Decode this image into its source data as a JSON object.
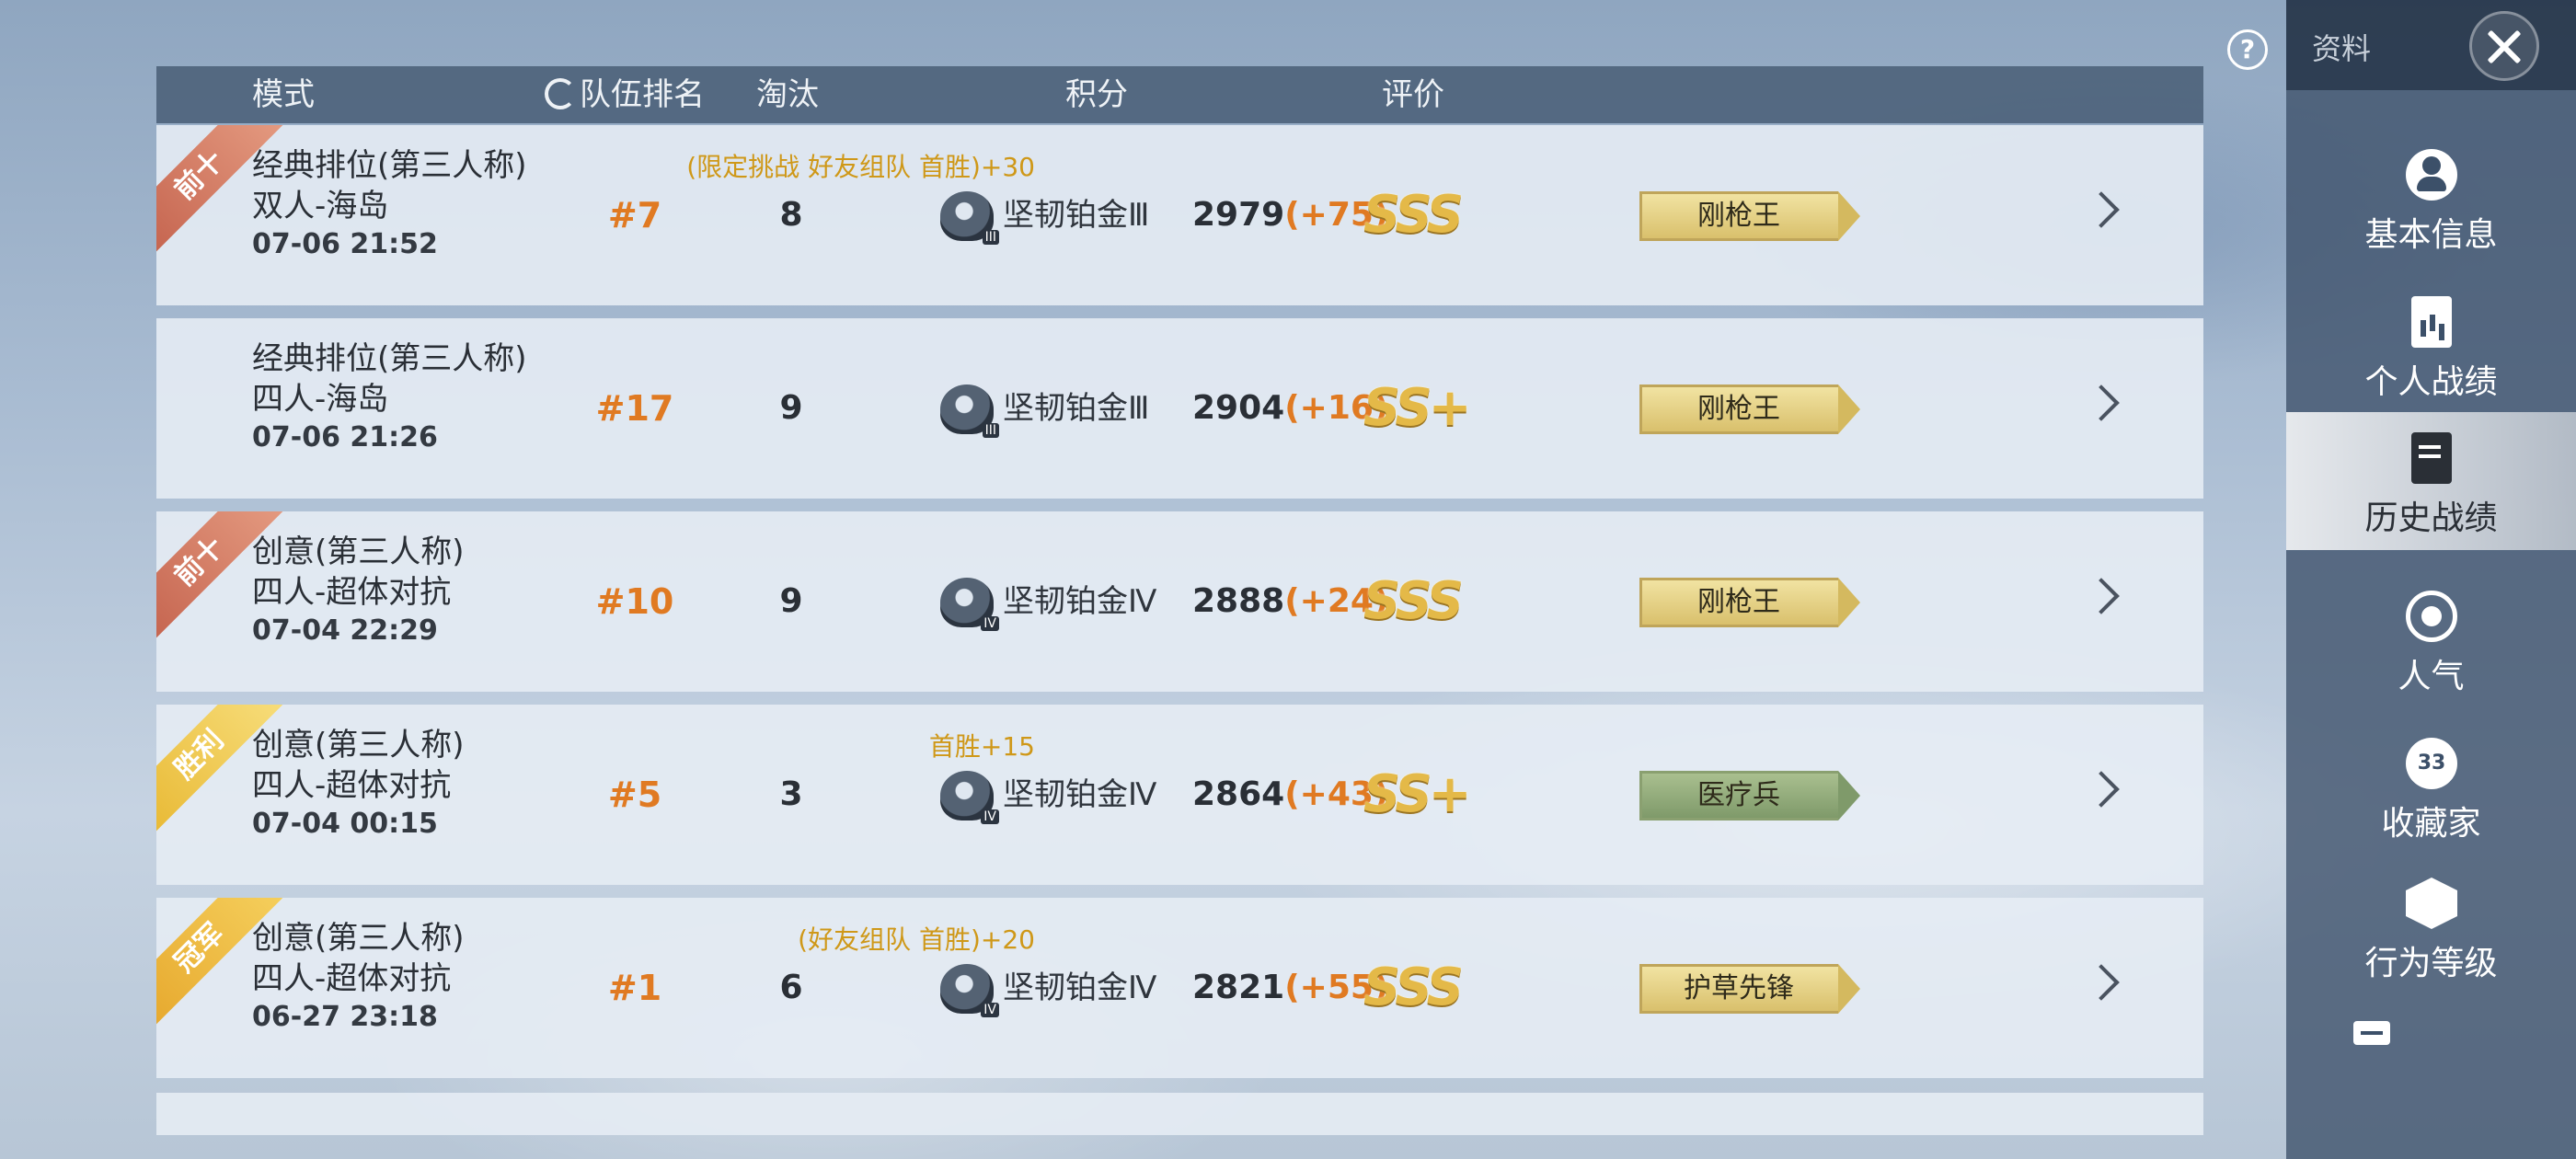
{
  "header": {
    "mode": "模式",
    "team_rank": "队伍排名",
    "kills": "淘汰",
    "score": "积分",
    "rating": "评价"
  },
  "sidebar": {
    "title": "资料",
    "items": [
      {
        "label": "基本信息",
        "icon": "user-icon",
        "active": false
      },
      {
        "label": "个人战绩",
        "icon": "stats-icon",
        "active": false
      },
      {
        "label": "历史战绩",
        "icon": "history-icon",
        "active": true
      },
      {
        "label": "人气",
        "icon": "popularity-icon",
        "active": false
      },
      {
        "label": "收藏家",
        "icon": "collector-icon",
        "active": false,
        "badge": "33"
      },
      {
        "label": "行为等级",
        "icon": "behavior-icon",
        "active": false
      }
    ]
  },
  "matches": [
    {
      "ribbon": "前十",
      "mode": "经典排位(第三人称)",
      "map": "双人-海岛",
      "date": "07-06 21:52",
      "rank": "#7",
      "kills": "8",
      "bonus": "(限定挑战 好友组队 首胜)+30",
      "tier": "坚韧铂金Ⅲ",
      "tier_roman": "III",
      "score": "2979",
      "delta": "(+75)",
      "grade": "SSS",
      "title": "刚枪王",
      "title_style": "gold"
    },
    {
      "ribbon": "",
      "mode": "经典排位(第三人称)",
      "map": "四人-海岛",
      "date": "07-06 21:26",
      "rank": "#17",
      "kills": "9",
      "bonus": "",
      "tier": "坚韧铂金Ⅲ",
      "tier_roman": "III",
      "score": "2904",
      "delta": "(+16)",
      "grade": "SS+",
      "title": "刚枪王",
      "title_style": "gold"
    },
    {
      "ribbon": "前十",
      "mode": "创意(第三人称)",
      "map": "四人-超体对抗",
      "date": "07-04 22:29",
      "rank": "#10",
      "kills": "9",
      "bonus": "",
      "tier": "坚韧铂金Ⅳ",
      "tier_roman": "IV",
      "score": "2888",
      "delta": "(+24)",
      "grade": "SSS",
      "title": "刚枪王",
      "title_style": "gold"
    },
    {
      "ribbon": "胜利",
      "mode": "创意(第三人称)",
      "map": "四人-超体对抗",
      "date": "07-04 00:15",
      "rank": "#5",
      "kills": "3",
      "bonus": "首胜+15",
      "tier": "坚韧铂金Ⅳ",
      "tier_roman": "IV",
      "score": "2864",
      "delta": "(+43)",
      "grade": "SS+",
      "title": "医疗兵",
      "title_style": "green"
    },
    {
      "ribbon": "冠军",
      "mode": "创意(第三人称)",
      "map": "四人-超体对抗",
      "date": "06-27 23:18",
      "rank": "#1",
      "kills": "6",
      "bonus": "(好友组队 首胜)+20",
      "tier": "坚韧铂金Ⅳ",
      "tier_roman": "IV",
      "score": "2821",
      "delta": "(+55)",
      "grade": "SSS",
      "title": "护草先锋",
      "title_style": "gold"
    }
  ]
}
